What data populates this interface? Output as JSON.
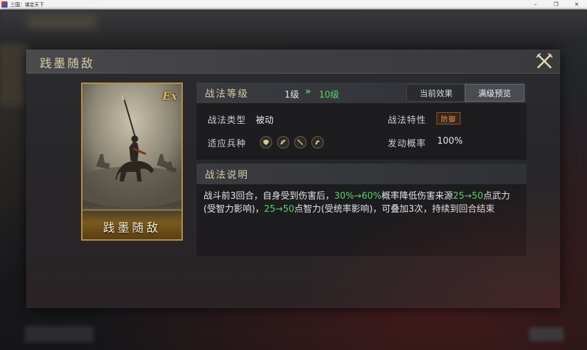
{
  "window": {
    "title": "三国：谋定天下",
    "controls": {
      "minimize": "–",
      "maximize": "❐",
      "close": "✕"
    }
  },
  "modal": {
    "title": "践墨随敌",
    "close_icon": "close-x-icon"
  },
  "card": {
    "name": "践墨随敌",
    "badge": "Ex"
  },
  "info": {
    "level_title": "战法等级",
    "level_from": "1级",
    "level_arrow": "»",
    "level_to": "10级",
    "tabs": [
      {
        "label": "当前效果",
        "active": false
      },
      {
        "label": "满级预览",
        "active": true
      }
    ],
    "type_label": "战法类型",
    "type_value": "被动",
    "trait_label": "战法特性",
    "trait_value": "防御",
    "units_label": "适应兵种",
    "unit_icons": [
      "shield-unit-icon",
      "bow-unit-icon",
      "spear-unit-icon",
      "horse-unit-icon"
    ],
    "chance_label": "发动概率",
    "chance_value": "100%"
  },
  "description": {
    "title": "战法说明",
    "parts": [
      {
        "text": "战斗前3回合，自身受到伤害后，",
        "highlight": false
      },
      {
        "text": "30%→60%",
        "highlight": true
      },
      {
        "text": "概率降低伤害来源",
        "highlight": false
      },
      {
        "text": "25→50",
        "highlight": true
      },
      {
        "text": "点武力(受智力影响)，",
        "highlight": false
      },
      {
        "text": "25→50",
        "highlight": true
      },
      {
        "text": "点智力(受统率影响)，可叠加3次，持续到回合结束",
        "highlight": false
      }
    ]
  },
  "colors": {
    "accent_gold": "#d9cda6",
    "highlight_green": "#58d36a",
    "card_border": "#b8903f"
  }
}
